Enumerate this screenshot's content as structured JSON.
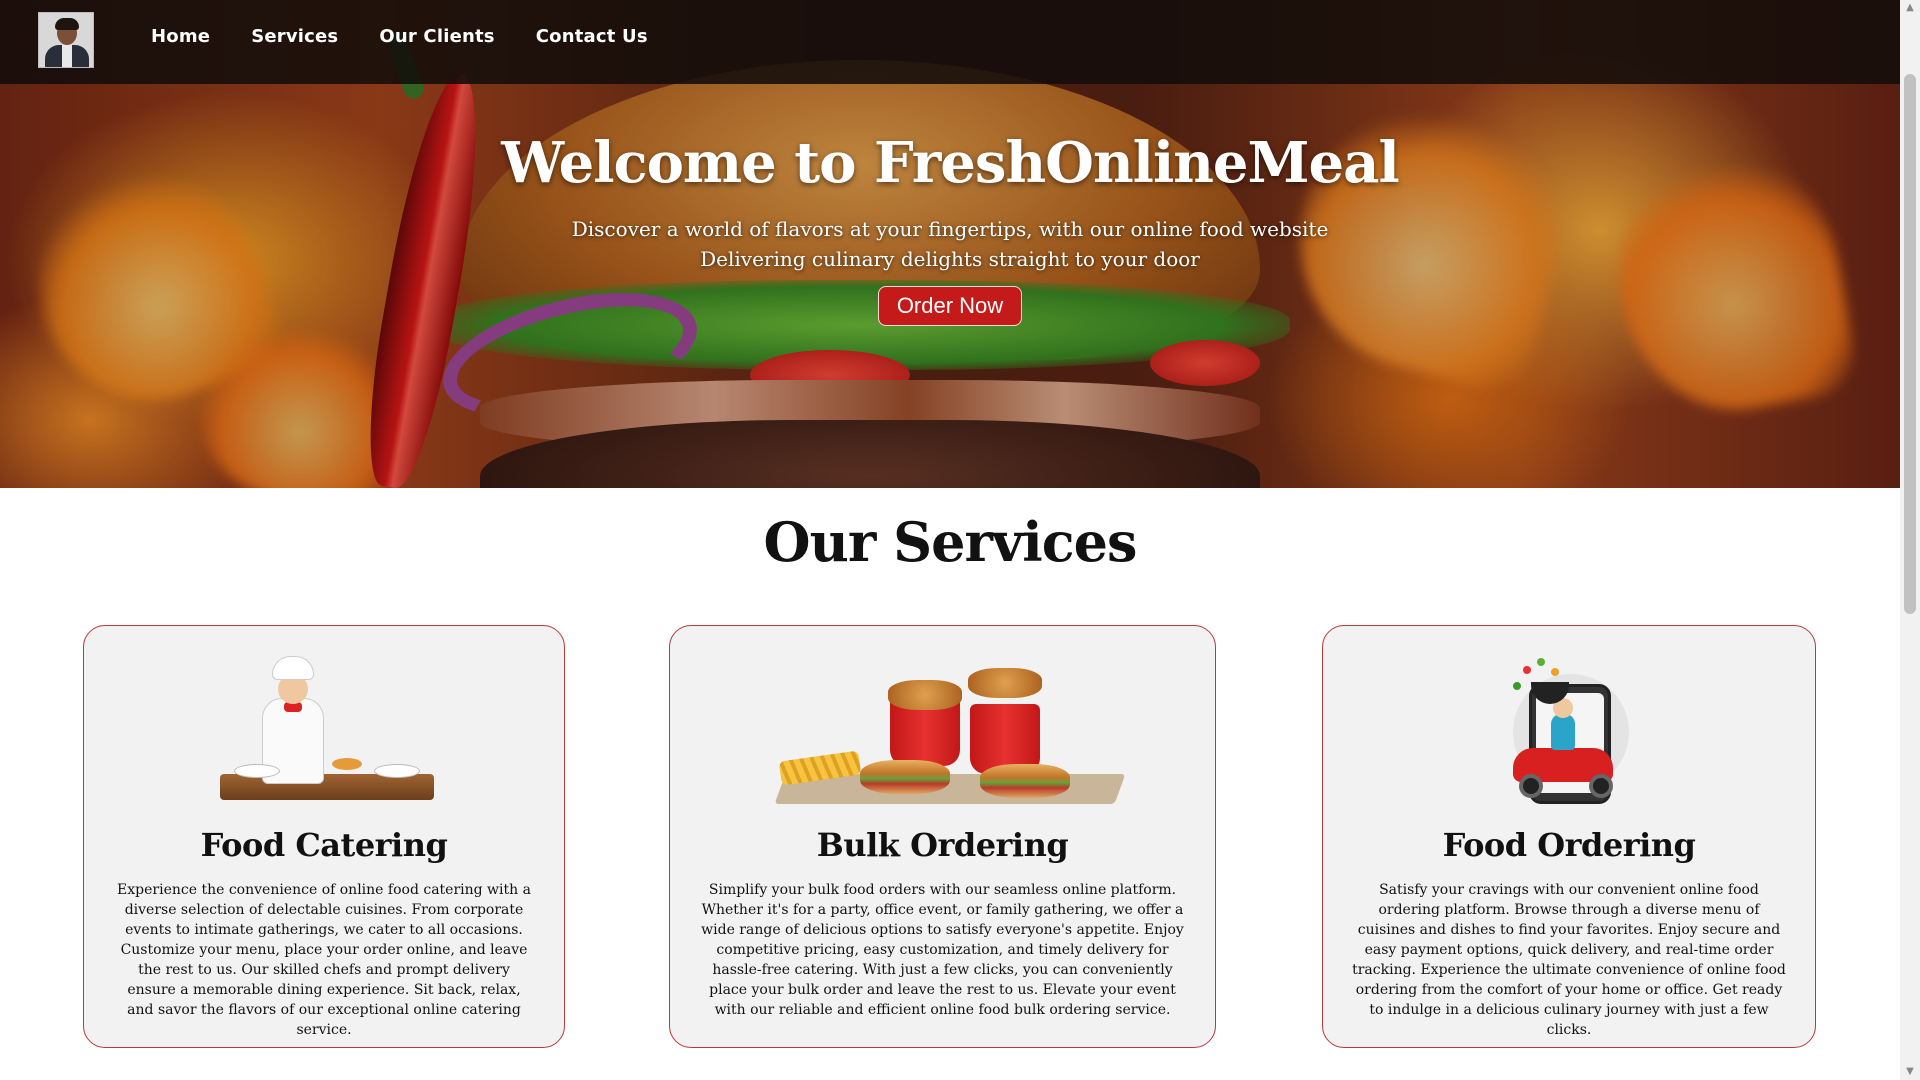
{
  "nav": {
    "avatar_icon": "profile-photo",
    "links": [
      "Home",
      "Services",
      "Our Clients",
      "Contact Us"
    ]
  },
  "hero": {
    "title": "Welcome to FreshOnlineMeal",
    "subtitle_line1": "Discover a world of flavors at your fingertips, with our online food website",
    "subtitle_line2": "Delivering culinary delights straight to your door",
    "cta": "Order Now"
  },
  "services": {
    "title": "Our Services",
    "cards": [
      {
        "title": "Food Catering",
        "icon": "chef-icon",
        "desc": "Experience the convenience of online food catering with a diverse selection of delectable cuisines. From corporate events to intimate gatherings, we cater to all occasions. Customize your menu, place your order online, and leave the rest to us. Our skilled chefs and prompt delivery ensure a memorable dining experience. Sit back, relax, and savor the flavors of our exceptional online catering service."
      },
      {
        "title": "Bulk Ordering",
        "icon": "bulk-food-icon",
        "desc": "Simplify your bulk food orders with our seamless online platform. Whether it's for a party, office event, or family gathering, we offer a wide range of delicious options to satisfy everyone's appetite. Enjoy competitive pricing, easy customization, and timely delivery for hassle-free catering. With just a few clicks, you can conveniently place your bulk order and leave the rest to us. Elevate your event with our reliable and efficient online food bulk ordering service."
      },
      {
        "title": "Food Ordering",
        "icon": "delivery-scooter-icon",
        "desc": "Satisfy your cravings with our convenient online food ordering platform. Browse through a diverse menu of cuisines and dishes to find your favorites. Enjoy secure and easy payment options, quick delivery, and real-time order tracking. Experience the ultimate convenience of online food ordering from the comfort of your home or office. Get ready to indulge in a delicious culinary journey with just a few clicks."
      }
    ]
  },
  "colors": {
    "accent": "#c41a1a",
    "card_border": "#b83a3a",
    "card_bg": "#f2f2f2",
    "nav_bg": "#120c0a"
  }
}
